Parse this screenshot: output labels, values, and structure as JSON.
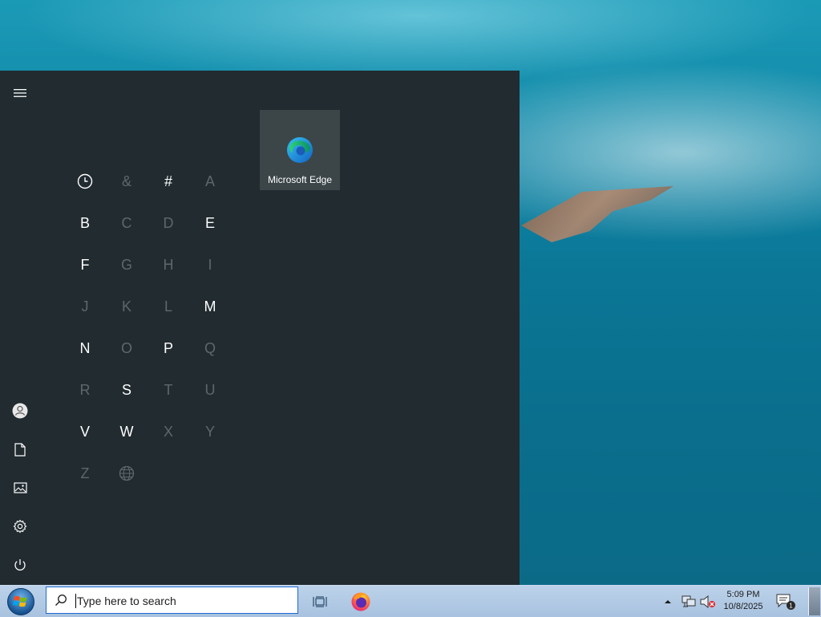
{
  "start_menu": {
    "tile": {
      "label": "Microsoft Edge",
      "icon": "edge-icon"
    },
    "rail": {
      "menu_icon": "hamburger-menu-icon",
      "user_icon": "user-icon",
      "documents_icon": "document-icon",
      "pictures_icon": "picture-icon",
      "settings_icon": "gear-icon",
      "power_icon": "power-icon"
    },
    "alphabet_grid": [
      {
        "glyph": "clock",
        "active": true
      },
      {
        "glyph": "&",
        "active": false
      },
      {
        "glyph": "#",
        "active": true
      },
      {
        "glyph": "A",
        "active": false
      },
      {
        "glyph": "B",
        "active": true
      },
      {
        "glyph": "C",
        "active": false
      },
      {
        "glyph": "D",
        "active": false
      },
      {
        "glyph": "E",
        "active": true
      },
      {
        "glyph": "F",
        "active": true
      },
      {
        "glyph": "G",
        "active": false
      },
      {
        "glyph": "H",
        "active": false
      },
      {
        "glyph": "I",
        "active": false
      },
      {
        "glyph": "J",
        "active": false
      },
      {
        "glyph": "K",
        "active": false
      },
      {
        "glyph": "L",
        "active": false
      },
      {
        "glyph": "M",
        "active": true
      },
      {
        "glyph": "N",
        "active": true
      },
      {
        "glyph": "O",
        "active": false
      },
      {
        "glyph": "P",
        "active": true
      },
      {
        "glyph": "Q",
        "active": false
      },
      {
        "glyph": "R",
        "active": false
      },
      {
        "glyph": "S",
        "active": true
      },
      {
        "glyph": "T",
        "active": false
      },
      {
        "glyph": "U",
        "active": false
      },
      {
        "glyph": "V",
        "active": true
      },
      {
        "glyph": "W",
        "active": true
      },
      {
        "glyph": "X",
        "active": false
      },
      {
        "glyph": "Y",
        "active": false
      },
      {
        "glyph": "Z",
        "active": false
      },
      {
        "glyph": "globe",
        "active": false
      }
    ]
  },
  "taskbar": {
    "search_placeholder": "Type here to search",
    "clock_time": "5:09 PM",
    "clock_date": "10/8/2025",
    "notification_count": "1",
    "colors": {
      "search_border": "#1e6bd1",
      "menu_bg": "#212b30",
      "tile_bg": "#3c4649"
    }
  }
}
